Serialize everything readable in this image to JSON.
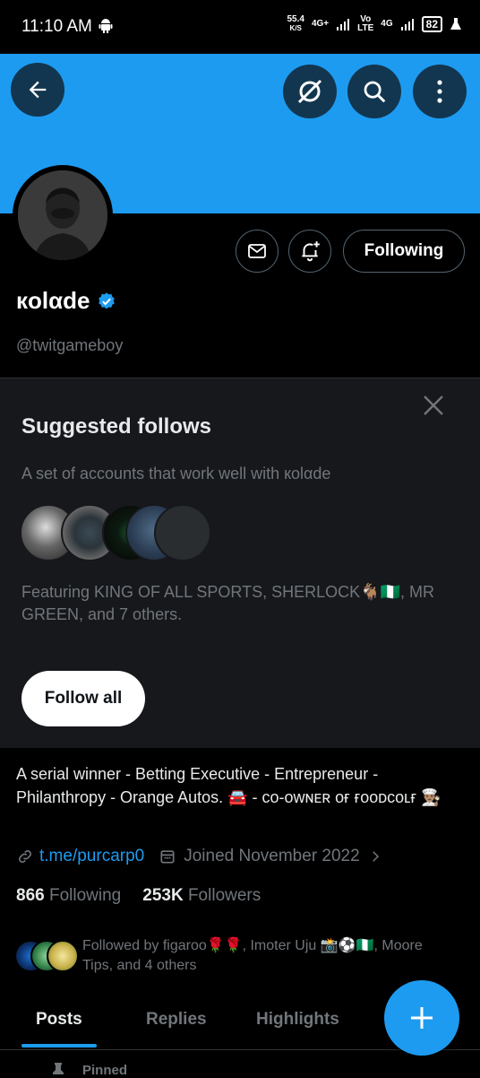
{
  "status_bar": {
    "time": "11:10 AM",
    "speed_value": "55.4",
    "speed_unit": "K/S",
    "net1": "4G+",
    "volte_top": "Vo",
    "volte_bottom": "LTE",
    "net2": "4G",
    "battery": "82"
  },
  "header": {
    "back_icon": "arrow-left-icon",
    "grok_icon": "grok-icon",
    "search_icon": "search-icon",
    "more_icon": "more-vertical-icon",
    "banner_color": "#1d9bf0"
  },
  "profile": {
    "display_name": "кolαde",
    "handle": "@twitgameboy",
    "following_button": "Following",
    "bio": "A serial winner  - Betting Executive - Entrepreneur - Philanthropy - Orange Autos. 🚘  - ᴄᴏ-ᴏᴡɴᴇʀ ᴏғ ғᴏᴏᴅᴄᴏʟғ 👨🏽‍🍳",
    "link": "t.me/purcarp0",
    "joined": "Joined November 2022",
    "following_count": "866",
    "following_label": "Following",
    "followers_count": "253K",
    "followers_label": "Followers",
    "followed_by": "Followed by figaroo🌹🌹, Imoter Uju 📸⚽🇳🇬, Moore Tips, and 4 others"
  },
  "suggested": {
    "title": "Suggested follows",
    "subtitle": "A set of accounts that work well with кolαde",
    "featuring": "Featuring KING OF ALL SPORTS, SHERLOCK🐐🇳🇬, MR GREEN, and 7 others.",
    "follow_all": "Follow all"
  },
  "tabs": [
    {
      "label": "Posts"
    },
    {
      "label": "Replies"
    },
    {
      "label": "Highlights"
    }
  ],
  "pinned_label": "Pinned",
  "accent_color": "#1d9bf0"
}
